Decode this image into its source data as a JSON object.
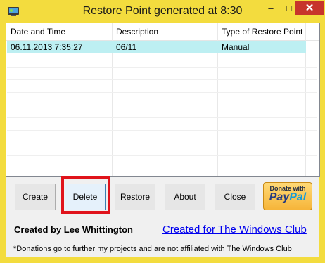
{
  "window": {
    "title": "Restore Point generated at 8:30",
    "controls": {
      "minimize": "–",
      "maximize": "□",
      "close": "✕"
    }
  },
  "list": {
    "columns": [
      "Date and Time",
      "Description",
      "Type of Restore Point"
    ],
    "rows": [
      {
        "date_time": "06.11.2013 7:35:27",
        "description": "06/11",
        "type": "Manual",
        "selected": true
      }
    ]
  },
  "buttons": {
    "create": "Create",
    "delete": "Delete",
    "restore": "Restore",
    "about": "About",
    "close": "Close"
  },
  "donate": {
    "line1": "Donate with",
    "brand_pay": "Pay",
    "brand_pal": "Pal"
  },
  "footer": {
    "created_by": "Created by Lee Whittington",
    "link": "Created for The Windows Club",
    "note": "*Donations go to further my projects and are not affiliated with The Windows Club"
  },
  "colors": {
    "titlebar": "#f3dc3e",
    "close_button": "#c7342b",
    "selected_row": "#bdeff2",
    "highlight_box": "#e0131b",
    "link": "#0000ee"
  },
  "icons": {
    "app": "restore-point-app-icon",
    "minimize": "minimize-icon",
    "maximize": "maximize-icon",
    "close": "close-icon"
  }
}
